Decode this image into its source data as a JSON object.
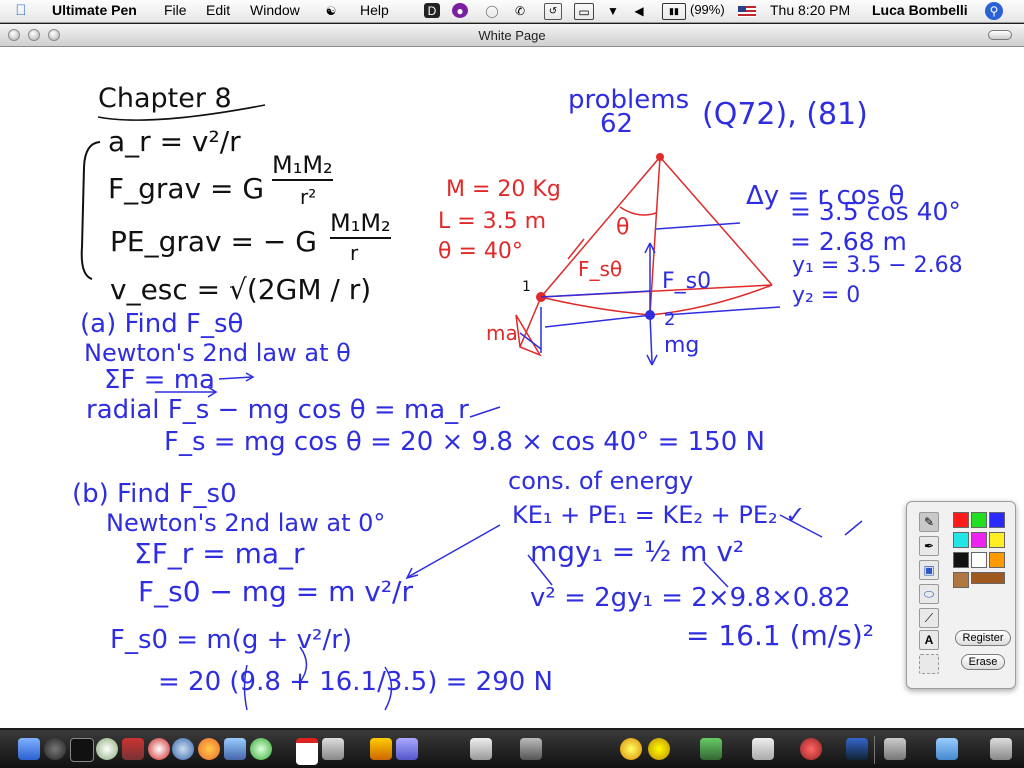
{
  "menubar": {
    "app_name": "Ultimate Pen",
    "menus": [
      "File",
      "Edit",
      "Window",
      "Help"
    ],
    "battery": "(99%)",
    "clock": "Thu 8:20 PM",
    "user": "Luca Bombelli"
  },
  "window": {
    "title": "White Page"
  },
  "notes": {
    "heading": "Chapter 8",
    "formulas": {
      "ar": "a_r = v²/r",
      "fgrav_left": "F_grav = G",
      "fgrav_frac_num": "M₁M₂",
      "fgrav_frac_den": "r²",
      "pegrav_left": "PE_grav = − G",
      "pegrav_frac_num": "M₁M₂",
      "pegrav_frac_den": "r",
      "vesc": "v_esc = √(2GM / r)"
    },
    "problems_header": "problems",
    "problems_num": "62",
    "problems_list": "(Q72), (81)",
    "given": {
      "mass": "M = 20 Kg",
      "length": "L = 3.5 m",
      "angle": "θ = 40°"
    },
    "diagram": {
      "theta": "θ",
      "point1": "1",
      "point2": "2",
      "f_s_theta": "F_sθ",
      "f_s0": "F_s0",
      "ma": "ma",
      "mg": "mg"
    },
    "dy": {
      "line1": "Δy = r cos θ",
      "line2": "= 3.5 cos 40°",
      "line3": "= 2.68 m",
      "line4": "y₁ = 3.5 − 2.68",
      "line5": "y₂ = 0"
    },
    "part_a": {
      "title": "(a) Find F_sθ",
      "line1": "Newton's 2nd law at θ",
      "line2": "ΣF = ma",
      "line3": "radial  F_s − mg cos θ = ma_r",
      "line4": "F_s = mg cos θ = 20 × 9.8 × cos 40° = 150 N"
    },
    "part_b": {
      "title": "(b) Find F_s0",
      "line1": "Newton's 2nd law at 0°",
      "line2": "ΣF_r = ma_r",
      "line3": "F_s0 − mg = m v²/r",
      "line4": "F_s0 = m(g + v²/r)",
      "line5": "= 20 (9.8 + 16.1/3.5) = 290 N"
    },
    "energy": {
      "title": "cons. of energy",
      "line1": "KE₁ + PE₁ = KE₂ + PE₂ ✓",
      "line2": "mgy₁ = ½ m v²",
      "line3": "v² = 2gy₁ = 2×9.8×0.82",
      "line4": "= 16.1 (m/s)²"
    }
  },
  "palette": {
    "tools": [
      "pencil-icon",
      "pen-icon",
      "rect-icon",
      "ellipse-icon",
      "line-icon",
      "text-icon",
      "select-icon"
    ],
    "text_tool": "A",
    "colors": [
      "#ff1a1a",
      "#22dd22",
      "#2a2aff",
      "#22e6e6",
      "#ee22ee",
      "#ffee22",
      "#111111",
      "#ffffff",
      "#ff9a00",
      "#b07840",
      "#a05a20"
    ],
    "register_label": "Register",
    "erase_label": "Erase"
  },
  "dock": {
    "icons": [
      "finder-icon",
      "dashboard-icon",
      "terminal-icon",
      "itunes-icon",
      "safari-icon",
      "firefox-icon",
      "mail-icon",
      "calendar-icon",
      "preview-icon",
      "iphoto-icon",
      "trash-icon"
    ]
  }
}
